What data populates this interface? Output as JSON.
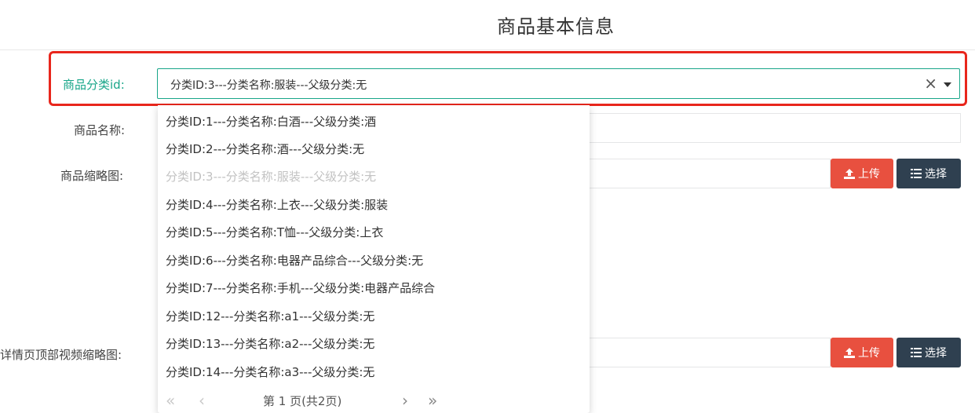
{
  "page": {
    "title": "商品基本信息"
  },
  "form": {
    "category": {
      "label": "商品分类id:",
      "selected": "分类ID:3---分类名称:服装---父级分类:无",
      "clear_symbol": "×"
    },
    "name": {
      "label": "商品名称:"
    },
    "thumbnail": {
      "label": "商品缩略图:",
      "upload_label": "上传",
      "choose_label": "选择"
    },
    "video_thumbnail": {
      "label": "详情页顶部视频缩略图:",
      "upload_label": "上传",
      "choose_label": "选择"
    }
  },
  "dropdown": {
    "options": [
      {
        "text": "分类ID:1---分类名称:白酒---父级分类:酒",
        "disabled": false
      },
      {
        "text": "分类ID:2---分类名称:酒---父级分类:无",
        "disabled": false
      },
      {
        "text": "分类ID:3---分类名称:服装---父级分类:无",
        "disabled": true
      },
      {
        "text": "分类ID:4---分类名称:上衣---父级分类:服装",
        "disabled": false
      },
      {
        "text": "分类ID:5---分类名称:T恤---父级分类:上衣",
        "disabled": false
      },
      {
        "text": "分类ID:6---分类名称:电器产品综合---父级分类:无",
        "disabled": false
      },
      {
        "text": "分类ID:7---分类名称:手机---父级分类:电器产品综合",
        "disabled": false
      },
      {
        "text": "分类ID:12---分类名称:a1---父级分类:无",
        "disabled": false
      },
      {
        "text": "分类ID:13---分类名称:a2---父级分类:无",
        "disabled": false
      },
      {
        "text": "分类ID:14---分类名称:a3---父级分类:无",
        "disabled": false
      }
    ],
    "pager": {
      "first": "«",
      "prev": "‹",
      "info": "第 1 页(共2页)",
      "next": "›",
      "last": "»"
    }
  },
  "colors": {
    "accent": "#18a689",
    "highlight": "#e8261c",
    "upload_button": "#e8503f",
    "choose_button": "#2f4050"
  },
  "icons": {
    "upload": "upload-icon",
    "choose": "list-icon",
    "clear": "close-icon",
    "caret": "caret-down-icon"
  }
}
